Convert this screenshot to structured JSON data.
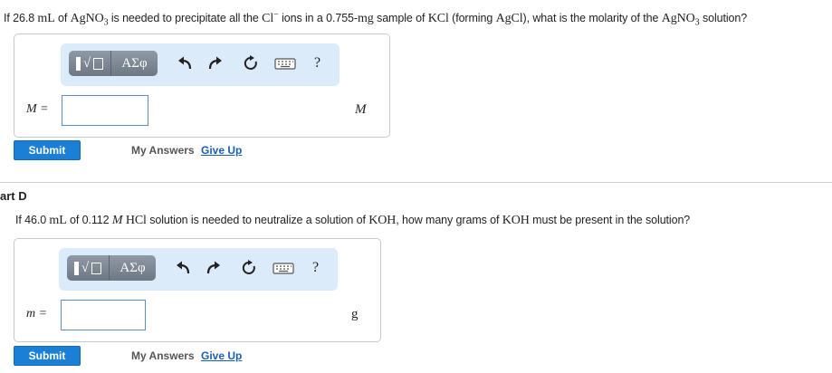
{
  "part_c": {
    "q_a": "If 26.8 ",
    "q_b": "mL",
    "q_c": " of ",
    "q_d": "AgNO",
    "q_sub": "3",
    "q_e": " is needed to precipitate all the ",
    "q_f": "Cl",
    "q_sup": "−",
    "q_g": " ions in a 0.755-",
    "q_h": "mg",
    "q_i": " sample of ",
    "q_j": "KCl",
    "q_k": " (forming ",
    "q_l": "AgCl",
    "q_m": "), what is the molarity of the ",
    "q_n": "AgNO",
    "q_sub2": "3",
    "q_o": " solution?",
    "var_label": "M =",
    "unit": "M",
    "submit_label": "Submit",
    "my_answers_label": "My Answers",
    "give_up_label": "Give Up"
  },
  "part_d": {
    "header": "art D",
    "q_a": "If 46.0 ",
    "q_b": "mL",
    "q_c": " of 0.112 ",
    "q_d": "M",
    "q_e": " ",
    "q_f": "HCl",
    "q_g": " solution is needed to neutralize a solution of ",
    "q_h": "KOH",
    "q_i": ", how many grams of ",
    "q_j": "KOH",
    "q_k": " must be present in the solution?",
    "var_label": "m =",
    "unit": "g",
    "submit_label": "Submit",
    "my_answers_label": "My Answers",
    "give_up_label": "Give Up"
  },
  "toolbar": {
    "sqrt_glyph": "√",
    "greek_label": "ΑΣφ",
    "help_label": "?",
    "icons": [
      "template-icon",
      "greek-symbols-icon",
      "undo-icon",
      "redo-icon",
      "reset-icon",
      "keyboard-icon",
      "help-icon"
    ]
  },
  "colors": {
    "toolbar_bg": "#dcebf9",
    "submit_bg": "#1c7fd6",
    "link": "#1a5fb4",
    "input_border": "#5b8ec9"
  }
}
